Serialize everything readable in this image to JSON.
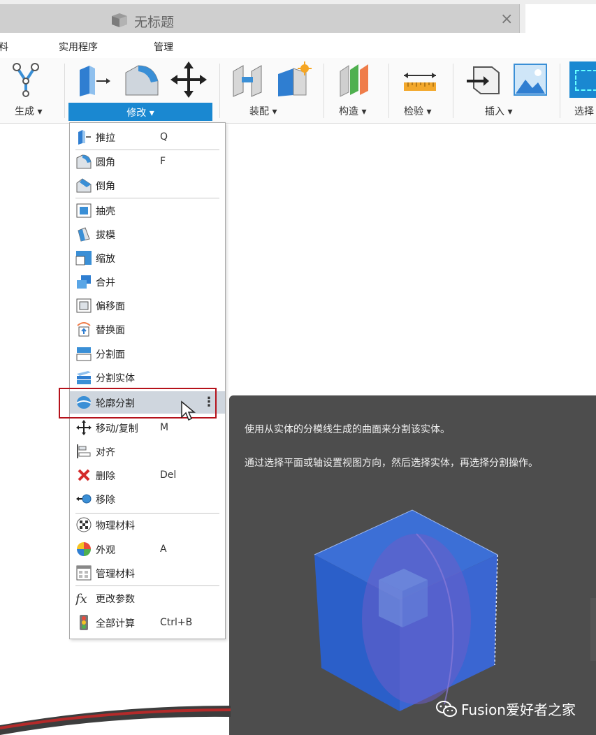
{
  "tab": {
    "title": "无标题",
    "close": "×"
  },
  "menu": {
    "partial_left": "料",
    "utilities": "实用程序",
    "manage": "管理"
  },
  "toolbar": {
    "create": "生成 ▾",
    "modify": "修改 ▾",
    "assemble": "装配 ▾",
    "construct": "构造 ▾",
    "inspect": "检验 ▾",
    "insert": "插入 ▾",
    "select": "选择",
    "accent_color": "#1a88d1"
  },
  "dropdown": {
    "items": [
      {
        "label": "推拉",
        "shortcut": "Q"
      },
      {
        "label": "圆角",
        "shortcut": "F"
      },
      {
        "label": "倒角",
        "shortcut": ""
      },
      {
        "label": "抽壳",
        "shortcut": ""
      },
      {
        "label": "拔模",
        "shortcut": ""
      },
      {
        "label": "缩放",
        "shortcut": ""
      },
      {
        "label": "合并",
        "shortcut": ""
      },
      {
        "label": "偏移面",
        "shortcut": ""
      },
      {
        "label": "替换面",
        "shortcut": ""
      },
      {
        "label": "分割面",
        "shortcut": ""
      },
      {
        "label": "分割实体",
        "shortcut": ""
      },
      {
        "label": "轮廓分割",
        "shortcut": ""
      },
      {
        "label": "移动/复制",
        "shortcut": "M"
      },
      {
        "label": "对齐",
        "shortcut": ""
      },
      {
        "label": "删除",
        "shortcut": "Del"
      },
      {
        "label": "移除",
        "shortcut": ""
      },
      {
        "label": "物理材料",
        "shortcut": ""
      },
      {
        "label": "外观",
        "shortcut": "A"
      },
      {
        "label": "管理材料",
        "shortcut": ""
      },
      {
        "label": "更改参数",
        "shortcut": ""
      },
      {
        "label": "全部计算",
        "shortcut": "Ctrl+B"
      }
    ],
    "more": "⋮"
  },
  "tooltip": {
    "line1": "使用从实体的分模线生成的曲面来分割该实体。",
    "line2": "通过选择平面或轴设置视图方向，然后选择实体，再选择分割操作。"
  },
  "watermark": "Fusion爱好者之家"
}
